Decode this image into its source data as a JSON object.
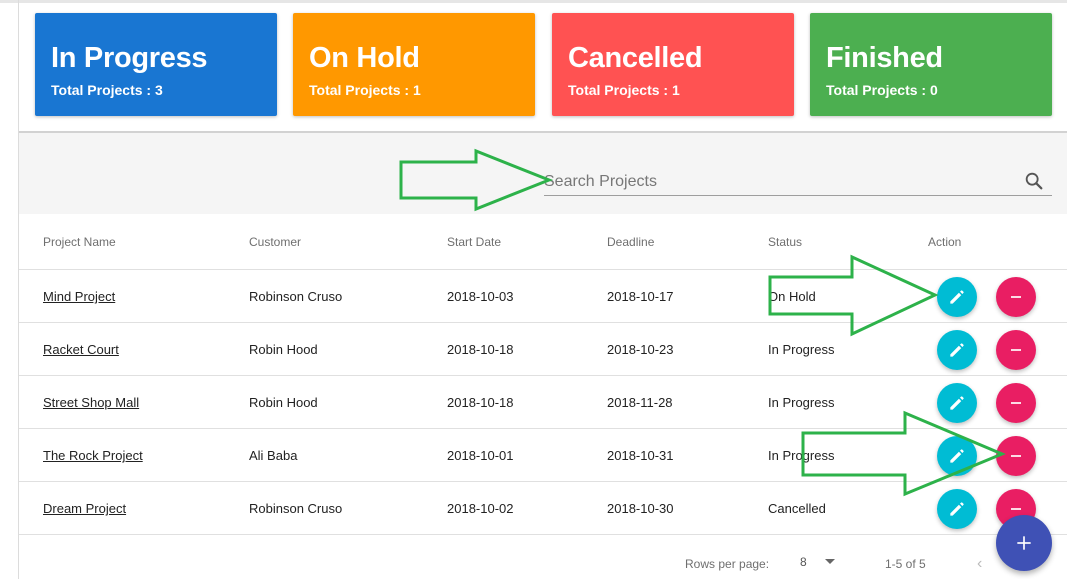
{
  "status_cards": [
    {
      "title": "In Progress",
      "subtitle": "Total Projects : 3",
      "color": "#1976d2"
    },
    {
      "title": "On Hold",
      "subtitle": "Total Projects : 1",
      "color": "#ff9800"
    },
    {
      "title": "Cancelled",
      "subtitle": "Total Projects : 1",
      "color": "#ff5252"
    },
    {
      "title": "Finished",
      "subtitle": "Total Projects : 0",
      "color": "#4caf50"
    }
  ],
  "search": {
    "placeholder": "Search Projects",
    "value": "",
    "icon": "search-icon"
  },
  "table": {
    "columns": [
      "Project Name",
      "Customer",
      "Start Date",
      "Deadline",
      "Status",
      "Action"
    ],
    "rows": [
      {
        "name": "Mind Project",
        "customer": "Robinson Cruso",
        "start": "2018-10-03",
        "deadline": "2018-10-17",
        "status": "On Hold"
      },
      {
        "name": "Racket Court",
        "customer": "Robin Hood",
        "start": "2018-10-18",
        "deadline": "2018-10-23",
        "status": "In Progress"
      },
      {
        "name": "Street Shop Mall",
        "customer": "Robin Hood",
        "start": "2018-10-18",
        "deadline": "2018-11-28",
        "status": "In Progress"
      },
      {
        "name": "The Rock Project",
        "customer": "Ali Baba",
        "start": "2018-10-01",
        "deadline": "2018-10-31",
        "status": "In Progress"
      },
      {
        "name": "Dream Project",
        "customer": "Robinson Cruso",
        "start": "2018-10-02",
        "deadline": "2018-10-30",
        "status": "Cancelled"
      }
    ],
    "action_icons": {
      "edit": "pencil-icon",
      "delete": "minus-icon"
    },
    "action_colors": {
      "edit": "#00bcd4",
      "delete": "#e91e63"
    }
  },
  "pagination": {
    "rows_per_page_label": "Rows per page:",
    "rows_per_page": "8",
    "range": "1-5 of 5"
  },
  "add_button": {
    "icon": "plus-icon",
    "color": "#3f51b5"
  },
  "annotations": {
    "arrow_color": "#2db24a",
    "arrow_targets": [
      "search-input",
      "edit-button",
      "delete-button"
    ]
  }
}
